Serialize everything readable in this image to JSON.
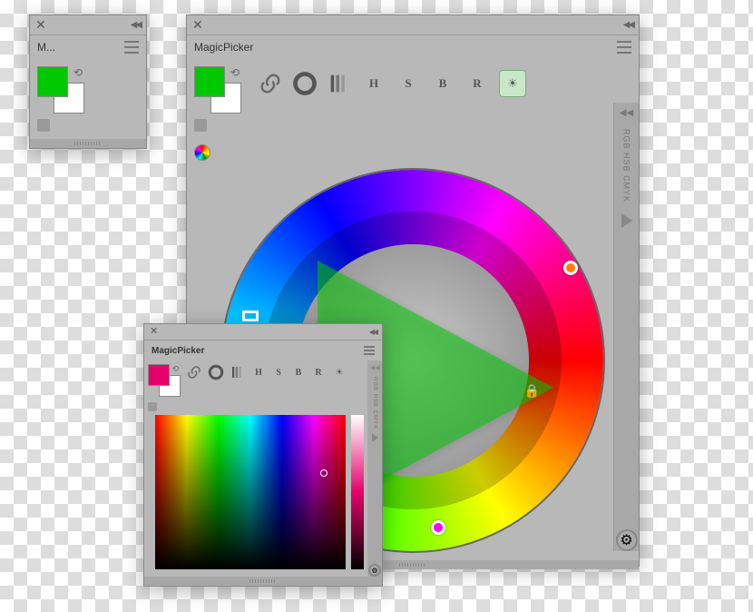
{
  "panels": {
    "mini": {
      "title": "M...",
      "fg": "#00c800",
      "bg": "#ffffff"
    },
    "main": {
      "title": "MagicPicker",
      "fg": "#00c800",
      "bg": "#ffffff",
      "toolbar": {
        "mode_letters": [
          "H",
          "S",
          "B",
          "R"
        ],
        "side_label": "RGB HSB CMYK"
      }
    },
    "small": {
      "title": "MagicPicker",
      "fg": "#e6006b",
      "bg": "#ffffff",
      "toolbar": {
        "mode_letters": [
          "H",
          "S",
          "B",
          "R"
        ],
        "side_label": "RGB HSB CMYK"
      }
    }
  }
}
